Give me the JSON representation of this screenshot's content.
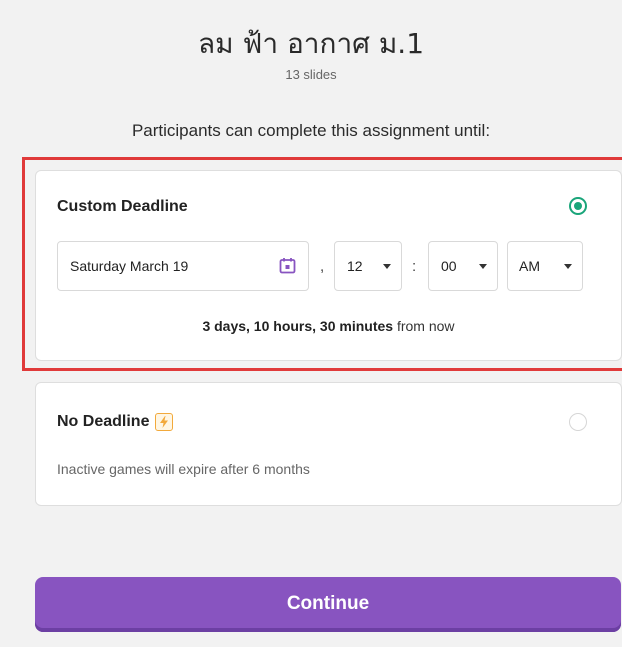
{
  "header": {
    "title": "ลม ฟ้า อากาศ ม.1",
    "subtitle": "13 slides",
    "prompt": "Participants can complete this assignment until:"
  },
  "custom_deadline": {
    "title": "Custom Deadline",
    "selected": true,
    "date_value": "Saturday March 19",
    "comma": ",",
    "hour_value": "12",
    "colon": ":",
    "minute_value": "00",
    "ampm_value": "AM",
    "remaining_bold": "3 days, 10 hours, 30 minutes",
    "remaining_suffix": "from now"
  },
  "no_deadline": {
    "title": "No Deadline",
    "selected": false,
    "description": "Inactive games will expire after 6 months"
  },
  "actions": {
    "continue_label": "Continue"
  },
  "colors": {
    "accent_purple": "#8854c0",
    "selected_green": "#1aa57a",
    "highlight_red": "#e03a3a",
    "bolt_orange": "#f2a93b"
  }
}
